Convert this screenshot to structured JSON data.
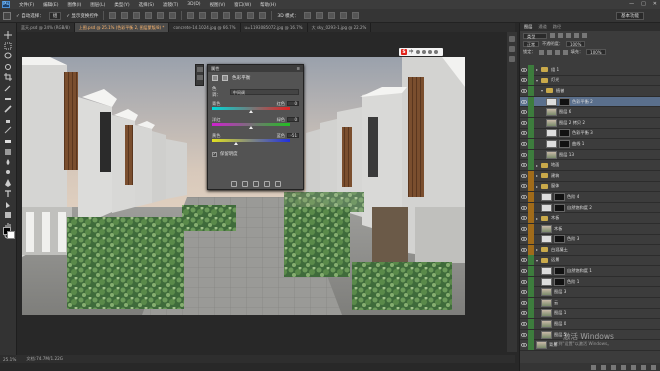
{
  "menubar": {
    "logo": "Ps",
    "items": [
      "文件(F)",
      "编辑(E)",
      "图像(I)",
      "图层(L)",
      "类型(Y)",
      "选择(S)",
      "滤镜(T)",
      "3D(D)",
      "视图(V)",
      "窗口(W)",
      "帮助(H)"
    ],
    "window_controls": [
      "—",
      "□",
      "✕"
    ]
  },
  "options_bar": {
    "auto_select_label": "✓ 自动选择：",
    "auto_select_value": "组",
    "show_transform_label": "✓ 显示变换控件",
    "workspace": "基本功能"
  },
  "doc_tabs": [
    {
      "label": "蓝天.psd @ 24% (RGB/8)",
      "active": false
    },
    {
      "label": "上图.psd @ 25.1% (色彩平衡 2, 图层蒙版/8) *",
      "active": true
    },
    {
      "label": "concrete-14.1024.jpg @ 66.7%",
      "active": false
    },
    {
      "label": "u=1193085072.jpg @ 16.7%",
      "active": false
    },
    {
      "label": "大 sky_0293-1.jpg @ 22.2%",
      "active": false
    }
  ],
  "status": {
    "zoom": "25.1%",
    "doc_size": "文档:74.7M/1.22G"
  },
  "ime": {
    "label": "中",
    "logo": "S"
  },
  "properties": {
    "header": "属性",
    "adj_title": "色彩平衡",
    "tone_label": "色调：",
    "tone_value": "中间调",
    "sliders": [
      {
        "left": "青色",
        "right": "红色",
        "value": "0",
        "position": 0.5
      },
      {
        "left": "洋红",
        "right": "绿色",
        "value": "0",
        "position": 0.5
      },
      {
        "left": "黄色",
        "right": "蓝色",
        "value": "-51",
        "position": 0.31
      }
    ],
    "preserve_luminosity": "保留明度",
    "preserve_checked": "✓"
  },
  "layers_panel": {
    "tabs": [
      "图层",
      "通道",
      "路径"
    ],
    "filter_label": "类型",
    "blend_mode": "正常",
    "opacity_label": "不透明度：",
    "opacity_value": "100%",
    "lock_label": "锁定：",
    "fill_label": "填充：",
    "fill_value": "100%",
    "layers": [
      {
        "name": "组 1",
        "indent": 0,
        "color": "#3d7c3d",
        "type": "folder",
        "open": false,
        "selected": false
      },
      {
        "name": "灯光",
        "indent": 0,
        "color": "#3d7c3d",
        "type": "folder",
        "open": true,
        "selected": false
      },
      {
        "name": "植被",
        "indent": 1,
        "color": "#3d7c3d",
        "type": "folder",
        "open": true,
        "selected": false
      },
      {
        "name": "色彩平衡 2",
        "indent": 2,
        "color": "#3d7c3d",
        "type": "adjust",
        "open": false,
        "selected": true
      },
      {
        "name": "图层 6",
        "indent": 2,
        "color": "#3d7c3d",
        "type": "layer",
        "open": false,
        "selected": false
      },
      {
        "name": "图层 2 拷贝 2",
        "indent": 2,
        "color": "#3d7c3d",
        "type": "layer",
        "open": false,
        "selected": false
      },
      {
        "name": "色彩平衡 3",
        "indent": 2,
        "color": "#3d7c3d",
        "type": "adjust",
        "open": false,
        "selected": false
      },
      {
        "name": "曲线 1",
        "indent": 2,
        "color": "#3d7c3d",
        "type": "adjust",
        "open": false,
        "selected": false
      },
      {
        "name": "图层 13",
        "indent": 2,
        "color": "#3d7c3d",
        "type": "layer",
        "open": false,
        "selected": false
      },
      {
        "name": "地面",
        "indent": 0,
        "color": "#3d7c3d",
        "type": "folder",
        "open": false,
        "selected": false
      },
      {
        "name": "建筑",
        "indent": 0,
        "color": "#a06b1a",
        "type": "folder",
        "open": false,
        "selected": false
      },
      {
        "name": "窗体",
        "indent": 0,
        "color": "#a06b1a",
        "type": "folder",
        "open": false,
        "selected": false
      },
      {
        "name": "色阶 4",
        "indent": 1,
        "color": "#a06b1a",
        "type": "adjust",
        "open": false,
        "selected": false
      },
      {
        "name": "自然饱和度 2",
        "indent": 1,
        "color": "#a06b1a",
        "type": "adjust",
        "open": false,
        "selected": false
      },
      {
        "name": "木板",
        "indent": 0,
        "color": "#a06b1a",
        "type": "folder",
        "open": false,
        "selected": false
      },
      {
        "name": "木板",
        "indent": 1,
        "color": "#a06b1a",
        "type": "layer",
        "open": false,
        "selected": false
      },
      {
        "name": "色阶 3",
        "indent": 1,
        "color": "#a06b1a",
        "type": "adjust",
        "open": false,
        "selected": false
      },
      {
        "name": "白混凝土",
        "indent": 0,
        "color": "#a06b1a",
        "type": "folder",
        "open": false,
        "selected": false
      },
      {
        "name": "远景",
        "indent": 0,
        "color": "#3d7c3d",
        "type": "folder",
        "open": true,
        "selected": false
      },
      {
        "name": "自然饱和度 1",
        "indent": 1,
        "color": "#3d7c3d",
        "type": "adjust",
        "open": false,
        "selected": false
      },
      {
        "name": "色阶 1",
        "indent": 1,
        "color": "#3d7c3d",
        "type": "adjust",
        "open": false,
        "selected": false
      },
      {
        "name": "图层 3",
        "indent": 1,
        "color": "#3d7c3d",
        "type": "layer",
        "open": false,
        "selected": false
      },
      {
        "name": "云",
        "indent": 1,
        "color": "#3d7c3d",
        "type": "layer",
        "open": false,
        "selected": false
      },
      {
        "name": "图层 1",
        "indent": 1,
        "color": "#3d7c3d",
        "type": "layer",
        "open": false,
        "selected": false
      },
      {
        "name": "图层 0",
        "indent": 1,
        "color": "#3d7c3d",
        "type": "layer",
        "open": false,
        "selected": false
      },
      {
        "name": "图层 5",
        "indent": 1,
        "color": "#3d7c3d",
        "type": "layer",
        "open": false,
        "selected": false
      },
      {
        "name": "背景",
        "indent": 0,
        "color": "#3d7c3d",
        "type": "layer",
        "open": false,
        "selected": false
      }
    ]
  },
  "watermark": {
    "line1": "激活 Windows",
    "line2": "转到\"设置\"以激活 Windows。"
  }
}
